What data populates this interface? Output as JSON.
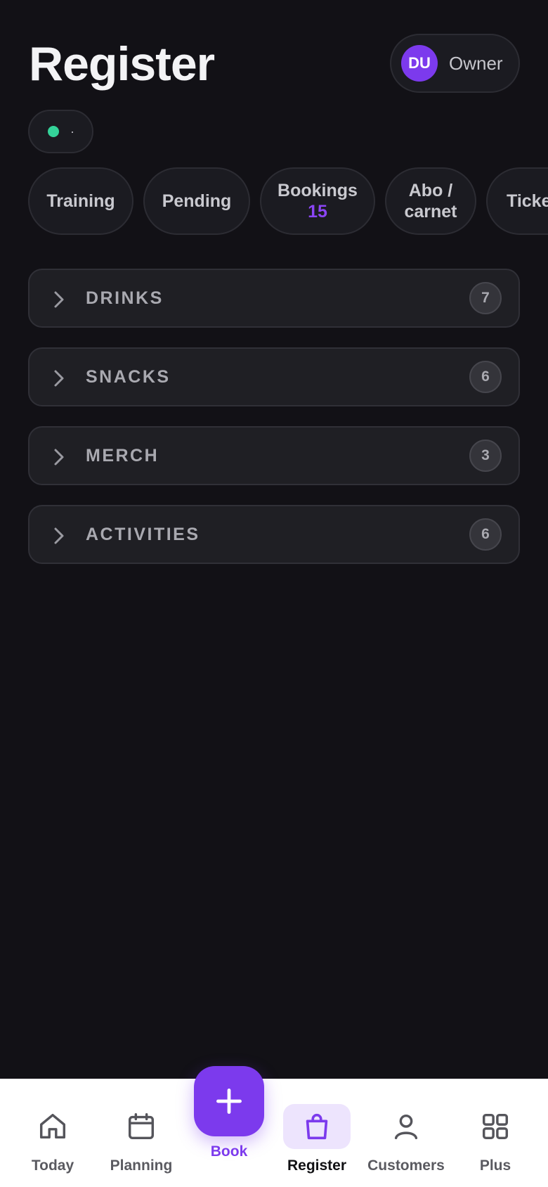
{
  "header": {
    "title": "Register",
    "user": {
      "initials": "DU",
      "role": "Owner"
    }
  },
  "status": {
    "text": "·",
    "color": "#34d399"
  },
  "tabs": [
    {
      "label": "Training",
      "count": ""
    },
    {
      "label": "Pending",
      "count": ""
    },
    {
      "label": "Bookings",
      "count": "15"
    },
    {
      "label": "Abo / carnet",
      "count": ""
    },
    {
      "label": "Ticke",
      "count": ""
    }
  ],
  "categories": [
    {
      "label": "DRINKS",
      "count": "7"
    },
    {
      "label": "SNACKS",
      "count": "6"
    },
    {
      "label": "MERCH",
      "count": "3"
    },
    {
      "label": "ACTIVITIES",
      "count": "6"
    }
  ],
  "nav": {
    "items": [
      {
        "label": "Today",
        "icon": "home-icon"
      },
      {
        "label": "Planning",
        "icon": "calendar-icon"
      },
      {
        "label": "Book",
        "icon": "plus-icon"
      },
      {
        "label": "Register",
        "icon": "shopping-bag-icon",
        "active": true
      },
      {
        "label": "Customers",
        "icon": "user-icon"
      },
      {
        "label": "Plus",
        "icon": "grid-icon"
      }
    ]
  },
  "colors": {
    "background": "#121116",
    "accent": "#7c3aed",
    "status_green": "#34d399",
    "nav_background": "#ffffff"
  }
}
